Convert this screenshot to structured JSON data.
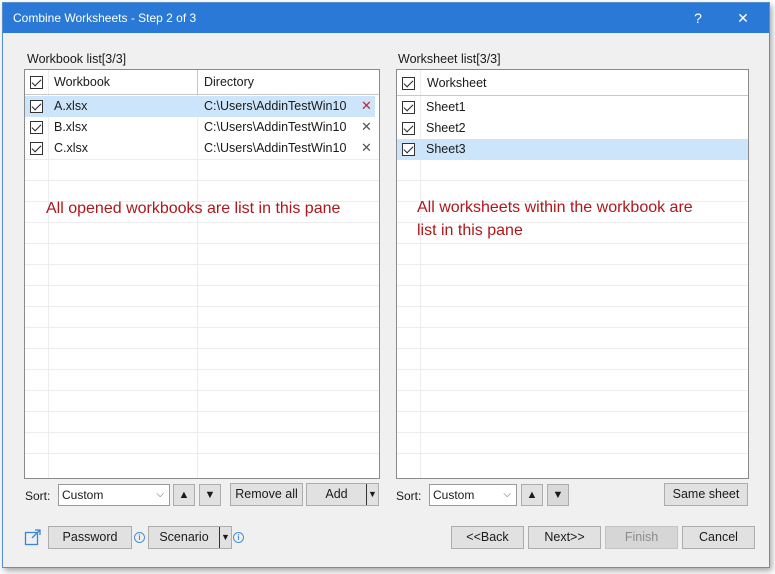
{
  "window": {
    "title": "Combine Worksheets - Step 2 of 3",
    "help_glyph": "?",
    "close_glyph": "✕"
  },
  "workbook_panel": {
    "label": "Workbook list[3/3]",
    "columns": {
      "workbook": "Workbook",
      "directory": "Directory"
    },
    "rows": [
      {
        "name": "A.xlsx",
        "dir": "C:\\Users\\AddinTestWin10",
        "selected": true
      },
      {
        "name": "B.xlsx",
        "dir": "C:\\Users\\AddinTestWin10",
        "selected": false
      },
      {
        "name": "C.xlsx",
        "dir": "C:\\Users\\AddinTestWin10",
        "selected": false
      }
    ],
    "annotation": "All opened workbooks are list in this pane",
    "sort_label": "Sort:",
    "sort_value": "Custom",
    "remove_all_label": "Remove all",
    "add_label": "Add"
  },
  "worksheet_panel": {
    "label": "Worksheet list[3/3]",
    "column": "Worksheet",
    "rows": [
      {
        "name": "Sheet1",
        "selected": false
      },
      {
        "name": "Sheet2",
        "selected": false
      },
      {
        "name": "Sheet3",
        "selected": true
      }
    ],
    "annotation_line1": "All worksheets within the workbook are",
    "annotation_line2": "list in this pane",
    "sort_label": "Sort:",
    "sort_value": "Custom",
    "same_sheet_label": "Same sheet"
  },
  "footer": {
    "password_label": "Password",
    "scenario_label": "Scenario",
    "back_label": "<<Back",
    "next_label": "Next>>",
    "finish_label": "Finish",
    "cancel_label": "Cancel"
  },
  "colors": {
    "accent": "#2b79d7",
    "selection": "#cde5fb",
    "annotation": "#b0161b",
    "delete_active": "#d0202a"
  }
}
